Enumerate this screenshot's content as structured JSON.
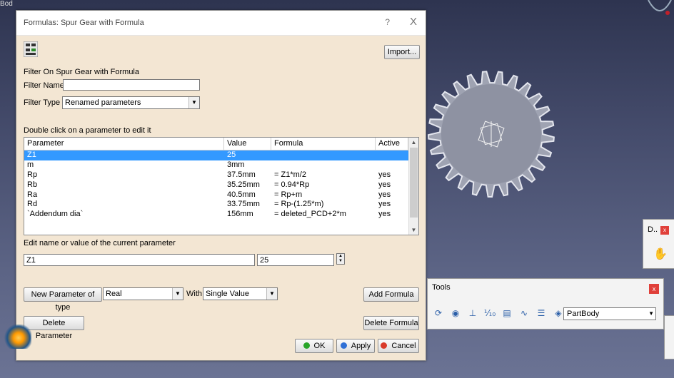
{
  "background": {
    "top_left_glyph": "Bod"
  },
  "dialog": {
    "title": "Formulas: Spur Gear with Formula",
    "help": "?",
    "close": "X",
    "import_label": "Import...",
    "filter_section": "Filter On Spur Gear with Formula",
    "filter_name_label": "Filter Name :",
    "filter_name_value": "",
    "filter_type_label": "Filter Type :",
    "filter_type_value": "Renamed parameters",
    "table_caption": "Double click on a parameter to edit it",
    "columns": [
      "Parameter",
      "Value",
      "Formula",
      "Active"
    ],
    "rows": [
      {
        "param": "Z1",
        "value": "25",
        "formula": "",
        "active": ""
      },
      {
        "param": "m",
        "value": "3mm",
        "formula": "",
        "active": ""
      },
      {
        "param": "Rp",
        "value": "37.5mm",
        "formula": "= Z1*m/2",
        "active": "yes"
      },
      {
        "param": "Rb",
        "value": "35.25mm",
        "formula": "= 0.94*Rp",
        "active": "yes"
      },
      {
        "param": "Ra",
        "value": "40.5mm",
        "formula": "= Rp+m",
        "active": "yes"
      },
      {
        "param": "Rd",
        "value": "33.75mm",
        "formula": "= Rp-(1.25*m)",
        "active": "yes"
      },
      {
        "param": "`Addendum dia`",
        "value": "156mm",
        "formula": "= deleted_PCD+2*m",
        "active": "yes"
      }
    ],
    "edit_caption": "Edit name or value of the current parameter",
    "edit_name": "Z1",
    "edit_value": "25",
    "new_param_label": "New Parameter of type",
    "param_type": "Real",
    "with_label": "With",
    "with_value": "Single Value",
    "add_formula_label": "Add Formula",
    "delete_param_label": "Delete Parameter",
    "delete_formula_label": "Delete Formula",
    "ok_label": "OK",
    "apply_label": "Apply",
    "cancel_label": "Cancel",
    "colors": {
      "selection": "#3399ff",
      "ok": "#2aa52a",
      "apply": "#2e6fd6",
      "cancel": "#d93a2a"
    }
  },
  "tools": {
    "title": "Tools",
    "close": "x",
    "part_body": "PartBody",
    "icons": [
      "update-icon",
      "scan-icon",
      "axis-icon",
      "measure-icon",
      "catalog-icon",
      "law-icon",
      "list-icon",
      "part-body-icon"
    ]
  },
  "mini_panel": {
    "label": "D..",
    "close": "x"
  }
}
